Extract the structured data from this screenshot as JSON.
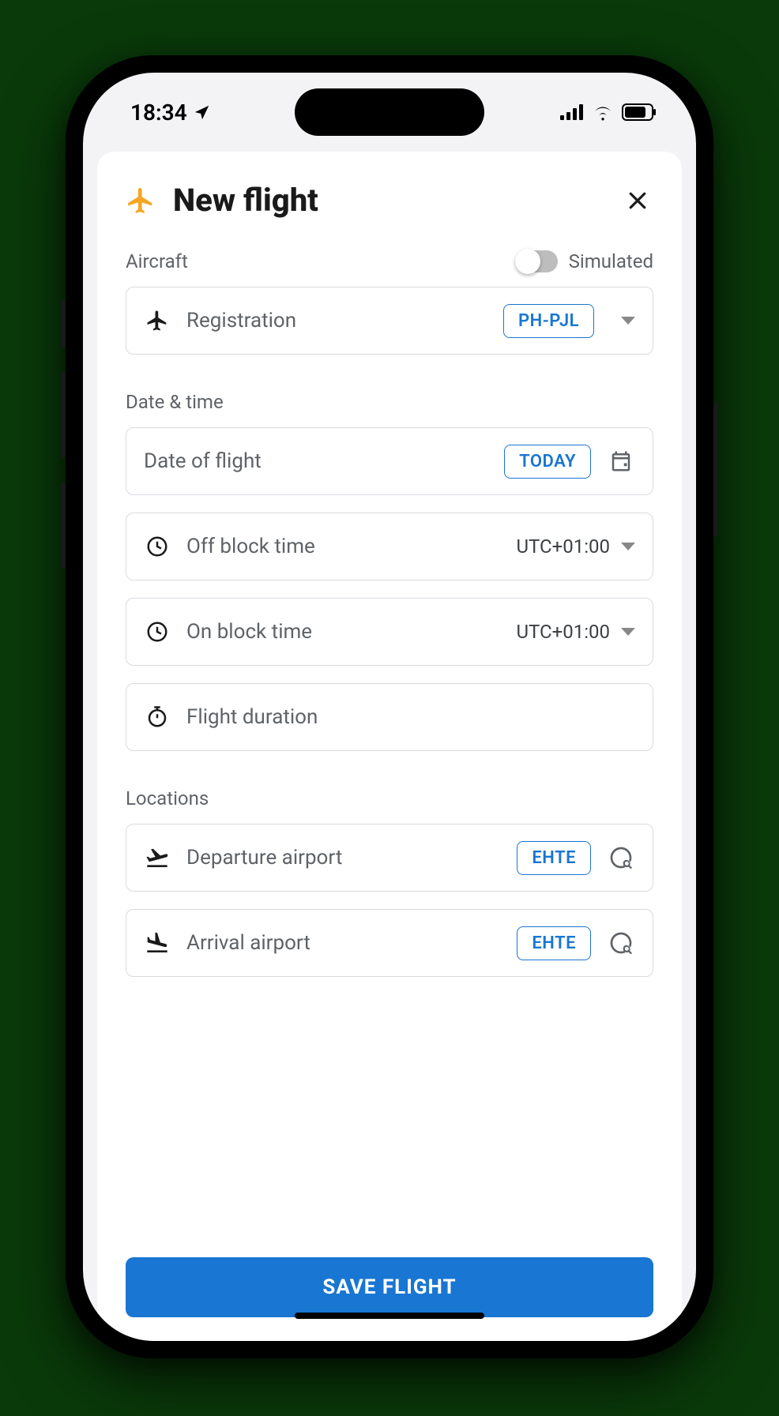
{
  "status": {
    "time": "18:34"
  },
  "header": {
    "title": "New flight"
  },
  "sections": {
    "aircraft": {
      "label": "Aircraft",
      "simulated_label": "Simulated",
      "registration_label": "Registration",
      "registration_value": "PH-PJL"
    },
    "datetime": {
      "label": "Date & time",
      "date_label": "Date of flight",
      "date_chip": "TODAY",
      "off_block_label": "Off block time",
      "off_block_tz": "UTC+01:00",
      "on_block_label": "On block time",
      "on_block_tz": "UTC+01:00",
      "duration_label": "Flight duration"
    },
    "locations": {
      "label": "Locations",
      "departure_label": "Departure airport",
      "departure_value": "EHTE",
      "arrival_label": "Arrival airport",
      "arrival_value": "EHTE"
    }
  },
  "actions": {
    "save": "SAVE FLIGHT"
  }
}
